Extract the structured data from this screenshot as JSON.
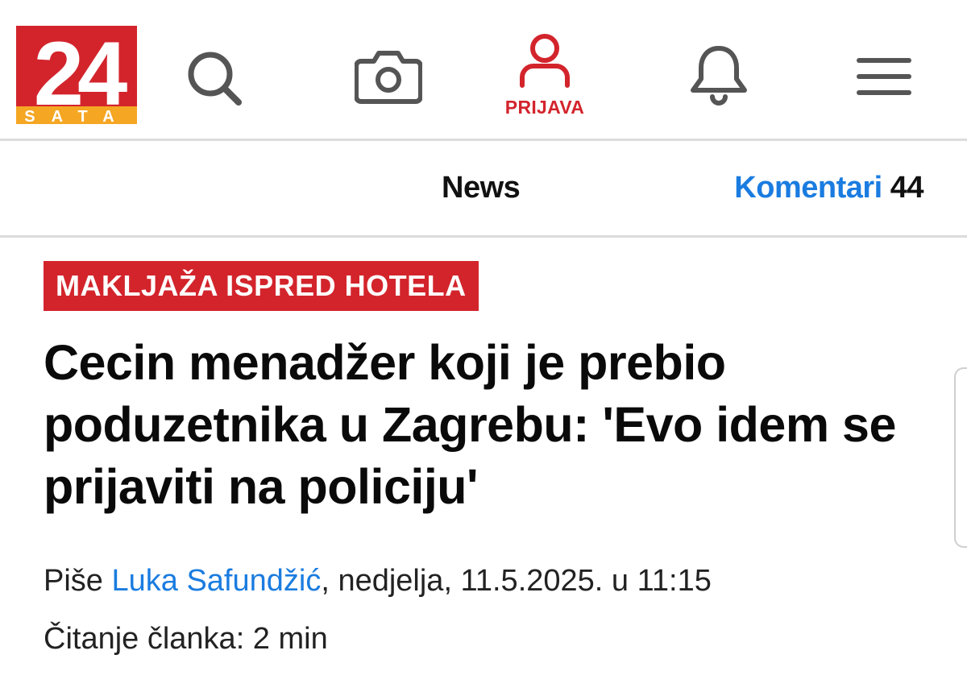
{
  "header": {
    "logo": {
      "number": "24",
      "word": "SATA"
    },
    "icons": [
      "search-icon",
      "camera-icon",
      "user-icon",
      "bell-icon",
      "menu-icon"
    ],
    "login_label": "PRIJAVA"
  },
  "subnav": {
    "section": "News",
    "comments_label": "Komentari",
    "comments_count": "44"
  },
  "article": {
    "kicker": "MAKLJAŽA ISPRED HOTELA",
    "headline": "Cecin menadžer koji je prebio poduzetnika u Zagrebu: 'Evo idem se prijaviti na policiju'",
    "byline_prefix": "Piše",
    "author": "Luka Safundžić",
    "date": ", nedjelja, 11.5.2025. u 11:15",
    "reading_time": "Čitanje članka: 2 min"
  },
  "colors": {
    "brand_red": "#d3242c",
    "brand_yellow": "#f5a623",
    "link_blue": "#1a7ce0",
    "icon_gray": "#555555"
  }
}
